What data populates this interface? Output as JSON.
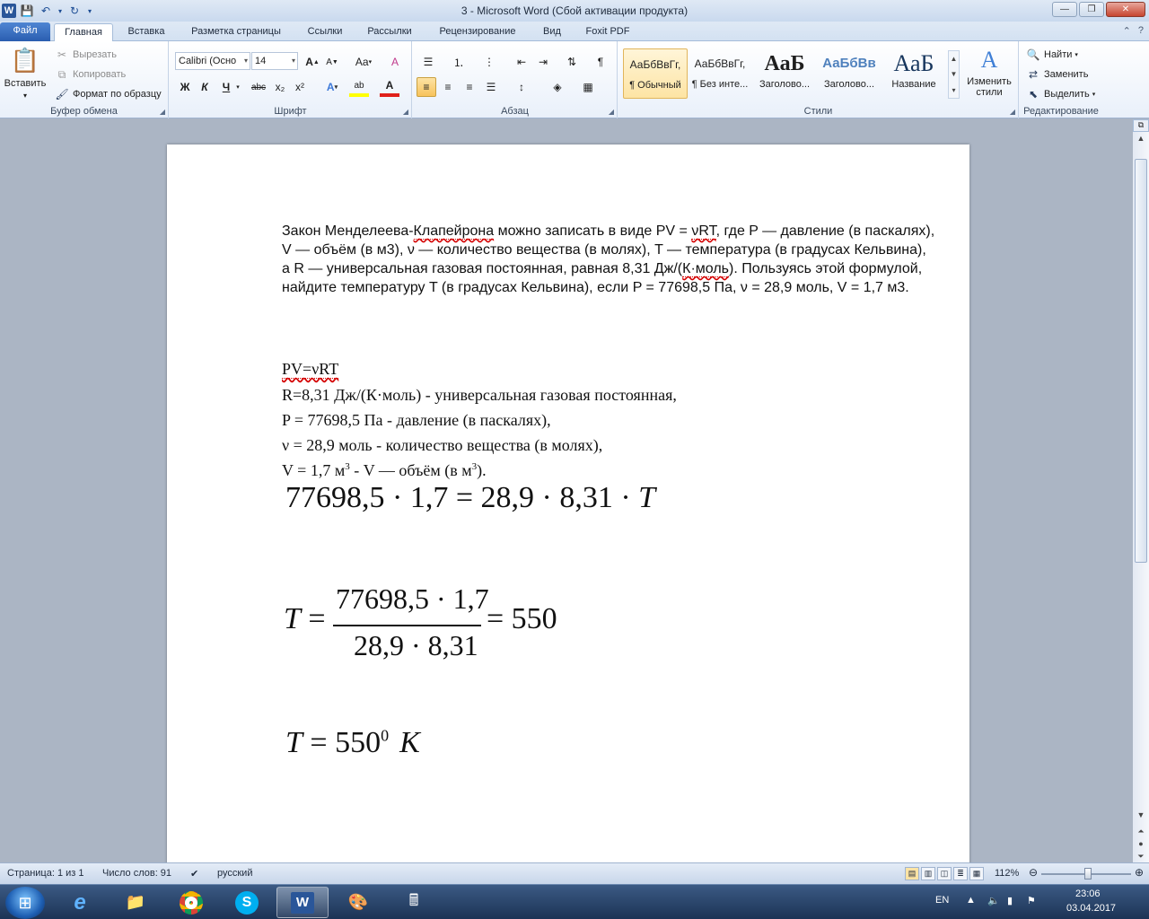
{
  "window": {
    "title": "3  -  Microsoft Word (Сбой активации продукта)",
    "app_icon": "W",
    "qat_save": "💾",
    "qat_undo": "↶",
    "qat_redo": "↻",
    "qat_more": "▾",
    "min": "—",
    "max": "❐",
    "close": "✕"
  },
  "tabs": [
    "Файл",
    "Главная",
    "Вставка",
    "Разметка страницы",
    "Ссылки",
    "Рассылки",
    "Рецензирование",
    "Вид",
    "Foxit PDF"
  ],
  "tabs_right": {
    "minimize": "⌃",
    "help": "?"
  },
  "ribbon": {
    "clipboard": {
      "label": "Буфер обмена",
      "paste": "Вставить",
      "cut": "Вырезать",
      "copy": "Копировать",
      "format_painter": "Формат по образцу"
    },
    "font": {
      "label": "Шрифт",
      "font_name": "Calibri (Осно",
      "font_size": "14",
      "grow": "A",
      "shrink": "A",
      "case": "Aa",
      "clear": "A",
      "bold": "Ж",
      "italic": "К",
      "underline": "Ч",
      "strike": "abc",
      "sub": "x₂",
      "sup": "x²",
      "effects": "A",
      "highlight": "ab",
      "color": "A"
    },
    "paragraph": {
      "label": "Абзац"
    },
    "styles": {
      "label": "Стили",
      "items": [
        {
          "preview": "АаБбВвГг,",
          "name": "¶ Обычный"
        },
        {
          "preview": "АаБбВвГг,",
          "name": "¶ Без инте..."
        },
        {
          "preview": "АаБ",
          "name": "Заголово..."
        },
        {
          "preview": "АаБбВв",
          "name": "Заголово..."
        },
        {
          "preview": "АаБ",
          "name": "Название"
        }
      ],
      "change": "Изменить стили"
    },
    "editing": {
      "label": "Редактирование",
      "find": "Найти",
      "replace": "Заменить",
      "select": "Выделить"
    }
  },
  "document": {
    "para_parts": {
      "p1": "Закон Менделеева-",
      "p1_sq": "Клапейрона",
      "p2": " можно записать в виде PV = ",
      "p2_sq": "νRT",
      "p3": ", где P — давление (в паскалях), V — объём (в м3), ν — количество вещества (в молях), T — температура (в градусах Кельвина), а R — универсальная газовая постоянная, равная 8,31 Дж/(",
      "p3_sq": "К·моль",
      "p4": "). Пользуясь этой формулой, найдите температуру T (в градусах Кельвина), если P = 77698,5 Па, ν = 28,9 моль, V = 1,7 м3."
    },
    "line1": "PV=νRT",
    "line2": "R=8,31 Дж/(К·моль) - универсальная газовая постоянная,",
    "line3": "P = 77698,5 Па - давление (в паскалях),",
    "line4": "ν = 28,9 моль - количество вещества (в молях),",
    "line5_a": "V = 1,7 м",
    "line5_sup1": "3",
    "line5_b": " - V — объём (в м",
    "line5_sup2": "3",
    "line5_c": ").",
    "eq1": "77698,5 · 1,7 = 28,9 · 8,31 · ",
    "eq1_var": "T",
    "eq2_lhs": "T",
    "eq2_eq": " = ",
    "eq2_num": "77698,5 · 1,7",
    "eq2_den": "28,9 · 8,31",
    "eq2_res": "= 550",
    "eq3_lhs": "T",
    "eq3_mid": " = 550",
    "eq3_sup": "0",
    "eq3_unit": "K"
  },
  "status": {
    "page": "Страница: 1 из 1",
    "words": "Число слов: 91",
    "lang": "русский",
    "zoom": "112%"
  },
  "taskbar": {
    "lang": "EN",
    "time": "23:06",
    "date": "03.04.2017"
  }
}
